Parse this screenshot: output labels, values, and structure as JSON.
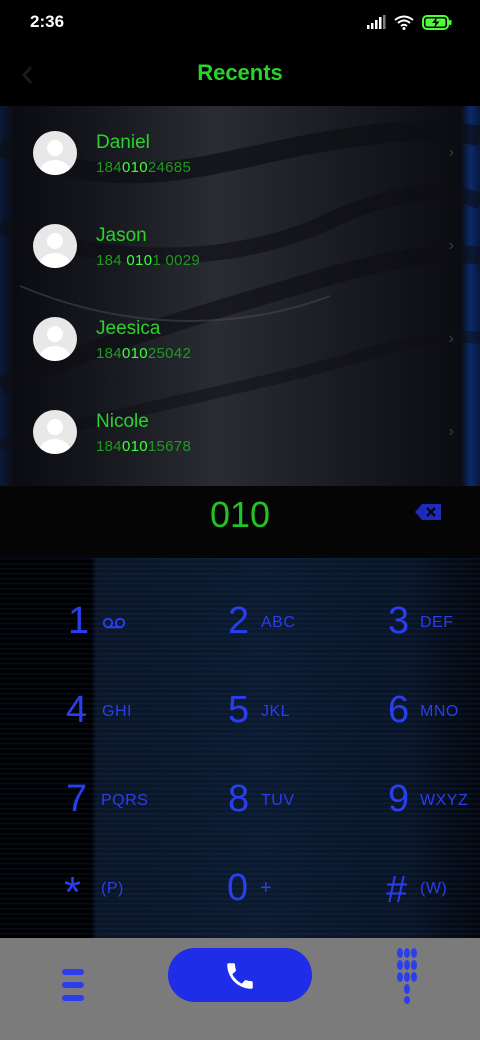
{
  "status_bar": {
    "time": "2:36"
  },
  "header": {
    "title": "Recents"
  },
  "recents": [
    {
      "name": "Daniel",
      "number_before": "184",
      "number_match": "010",
      "number_after": "24685"
    },
    {
      "name": "Jason",
      "number_before": "184 ",
      "number_match": "010",
      "number_after": "1 0029"
    },
    {
      "name": "Jeesica",
      "number_before": "184",
      "number_match": "010",
      "number_after": "25042"
    },
    {
      "name": "Nicole",
      "number_before": "184",
      "number_match": "010",
      "number_after": "15678"
    }
  ],
  "dialer": {
    "input": "010"
  },
  "keypad": {
    "keys": [
      {
        "digit": "1",
        "letters": "oo"
      },
      {
        "digit": "2",
        "letters": "ABC"
      },
      {
        "digit": "3",
        "letters": "DEF"
      },
      {
        "digit": "4",
        "letters": "GHI"
      },
      {
        "digit": "5",
        "letters": "JKL"
      },
      {
        "digit": "6",
        "letters": "MNO"
      },
      {
        "digit": "7",
        "letters": "PQRS"
      },
      {
        "digit": "8",
        "letters": "TUV"
      },
      {
        "digit": "9",
        "letters": "WXYZ"
      },
      {
        "digit": "*",
        "letters": "(P)"
      },
      {
        "digit": "0",
        "letters": "+"
      },
      {
        "digit": "#",
        "letters": "(W)"
      }
    ]
  },
  "icons": {
    "back": "back-arrow-icon",
    "backspace": "backspace-icon",
    "call": "phone-icon",
    "menu": "menu-icon",
    "dialpad": "dialpad-icon",
    "voicemail": "voicemail-icon"
  },
  "colors": {
    "accent_green": "#2ad32a",
    "key_blue": "#2a3ef0",
    "call_button": "#1f2ce8",
    "bottom_bar": "#7b7b7b"
  }
}
